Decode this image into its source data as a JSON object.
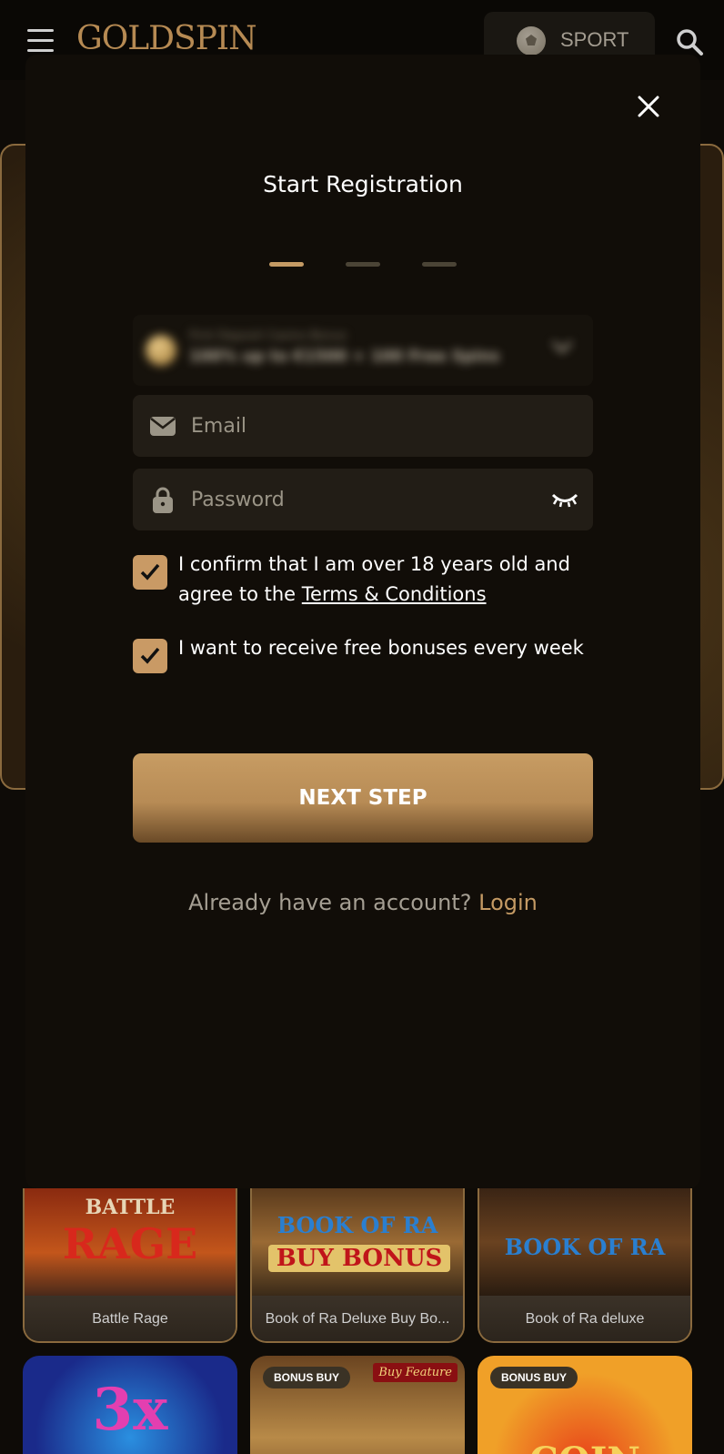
{
  "header": {
    "logo_text": "GOLDSPIN",
    "sport_label": "SPORT"
  },
  "modal": {
    "title": "Start Registration",
    "steps": {
      "total": 3,
      "current": 1
    },
    "bonus_select": {
      "label": "First Deposit Casino Bonus",
      "value": "100% up to €1500 + 100 Free Spins"
    },
    "email": {
      "placeholder": "Email",
      "value": ""
    },
    "password": {
      "placeholder": "Password",
      "value": ""
    },
    "age_confirm": {
      "checked": true,
      "text": "I confirm that I am over 18 years old and agree to the ",
      "link_text": "Terms & Conditions"
    },
    "bonus_optin": {
      "checked": true,
      "text": "I want to receive free bonuses every week"
    },
    "next_button": "NEXT STEP",
    "login_prompt": "Already have an account?",
    "login_link": "Login"
  },
  "games": [
    {
      "title": "Battle Rage",
      "art_text_1": "BATTLE",
      "art_text_2": "RAGE"
    },
    {
      "title": "Book of Ra Deluxe Buy Bo...",
      "art_text_1": "BOOK OF RA",
      "art_text_2": "BUY BONUS"
    },
    {
      "title": "Book of Ra deluxe",
      "art_text_1": "BOOK OF RA",
      "art_text_2": ""
    }
  ],
  "game_thumbs": [
    {
      "badge": "",
      "art_text": "3x"
    },
    {
      "badge": "BONUS BUY",
      "art_text": "Buy Feature"
    },
    {
      "badge": "BONUS BUY",
      "art_text": "COIN"
    }
  ],
  "colors": {
    "accent": "#c49a64",
    "modal_bg": "#110d08",
    "field_bg": "#221d16",
    "page_bg": "#0e0b07"
  }
}
